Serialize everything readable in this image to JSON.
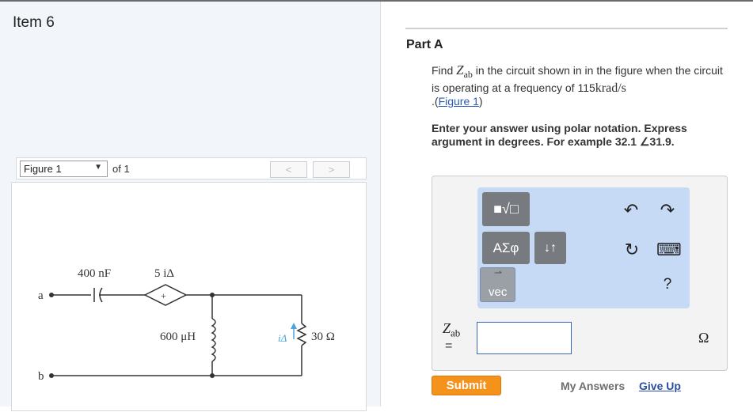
{
  "item": {
    "title": "Item 6"
  },
  "figure_nav": {
    "select_value": "Figure 1",
    "of_label": "of 1",
    "prev_label": "<",
    "next_label": ">"
  },
  "circuit": {
    "capacitor_label": "400 nF",
    "source_label": "5 iΔ",
    "source_sign": "+",
    "inductor_label": "600 μH",
    "resistor_label": "30 Ω",
    "current_label": "iΔ",
    "node_a": "a",
    "node_b": "b"
  },
  "part": {
    "title": "Part A",
    "question_pre": "Find ",
    "question_var": "Z",
    "question_sub": "ab",
    "question_mid": " in the circuit shown in in the figure when the circuit is operating at a frequency of 115",
    "question_unit": "krad/s",
    "question_link_pre": ".(",
    "question_link": "Figure 1",
    "question_link_post": ")",
    "instructions": "Enter your answer using polar notation. Express argument in degrees. For example 32.1 ∠31.9."
  },
  "toolbar": {
    "templates_label": "■√□",
    "greek_label": "ΑΣφ",
    "arrows_label": "↓↑",
    "vec_label": "vec",
    "vec_accent": "⇀",
    "undo_icon": "↶",
    "redo_icon": "↷",
    "reset_icon": "↻",
    "keyboard_icon": "⌨",
    "help_label": "?"
  },
  "answer": {
    "label_var": "Z",
    "label_sub": "ab",
    "label_eq": "=",
    "input_value": "",
    "unit": "Ω"
  },
  "actions": {
    "submit_label": "Submit",
    "my_answers_label": "My Answers",
    "give_up_label": "Give Up"
  },
  "colors": {
    "submit_bg": "#f4921c",
    "link": "#2a5db0",
    "toolbar_bg": "#c6d9f5"
  }
}
